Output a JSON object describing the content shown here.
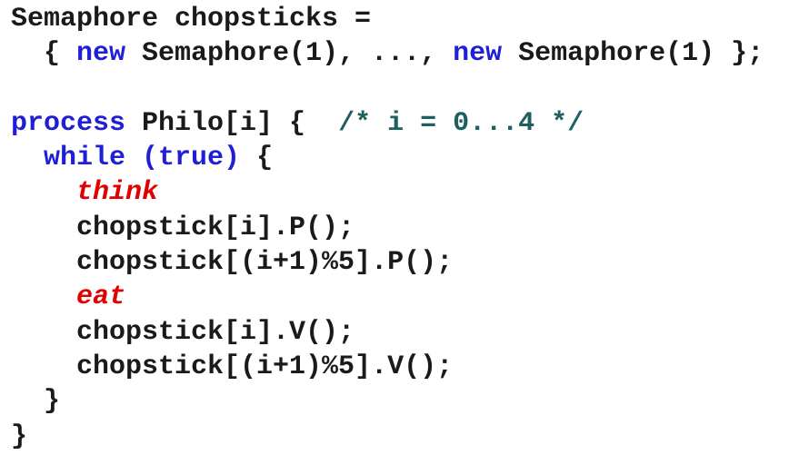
{
  "lines": [
    [
      {
        "t": "Semaphore chopsticks =",
        "c": "plain"
      }
    ],
    [
      {
        "t": "  { ",
        "c": "plain"
      },
      {
        "t": "new",
        "c": "kw"
      },
      {
        "t": " Semaphore(1), ..., ",
        "c": "plain"
      },
      {
        "t": "new",
        "c": "kw"
      },
      {
        "t": " Semaphore(1) };",
        "c": "plain"
      }
    ],
    [
      {
        "t": "",
        "c": "plain"
      }
    ],
    [
      {
        "t": "process",
        "c": "kw"
      },
      {
        "t": " Philo[i] {  ",
        "c": "plain"
      },
      {
        "t": "/* i = 0...4 */",
        "c": "cm"
      }
    ],
    [
      {
        "t": "  ",
        "c": "plain"
      },
      {
        "t": "while",
        "c": "kw"
      },
      {
        "t": " ",
        "c": "plain"
      },
      {
        "t": "(true)",
        "c": "kw"
      },
      {
        "t": " {",
        "c": "plain"
      }
    ],
    [
      {
        "t": "    ",
        "c": "plain"
      },
      {
        "t": "think",
        "c": "hl"
      }
    ],
    [
      {
        "t": "    chopstick[i].P();",
        "c": "plain"
      }
    ],
    [
      {
        "t": "    chopstick[(i+1)%5].P();",
        "c": "plain"
      }
    ],
    [
      {
        "t": "    ",
        "c": "plain"
      },
      {
        "t": "eat",
        "c": "hl"
      }
    ],
    [
      {
        "t": "    chopstick[i].V();",
        "c": "plain"
      }
    ],
    [
      {
        "t": "    chopstick[(i+1)%5].V();",
        "c": "plain"
      }
    ],
    [
      {
        "t": "  }",
        "c": "plain"
      }
    ],
    [
      {
        "t": "}",
        "c": "plain"
      }
    ]
  ],
  "colors": {
    "plain": "#1a1a1a",
    "keyword": "#1f1fd6",
    "comment": "#1f5f5f",
    "highlight": "#e00000",
    "background": "#ffffff"
  }
}
